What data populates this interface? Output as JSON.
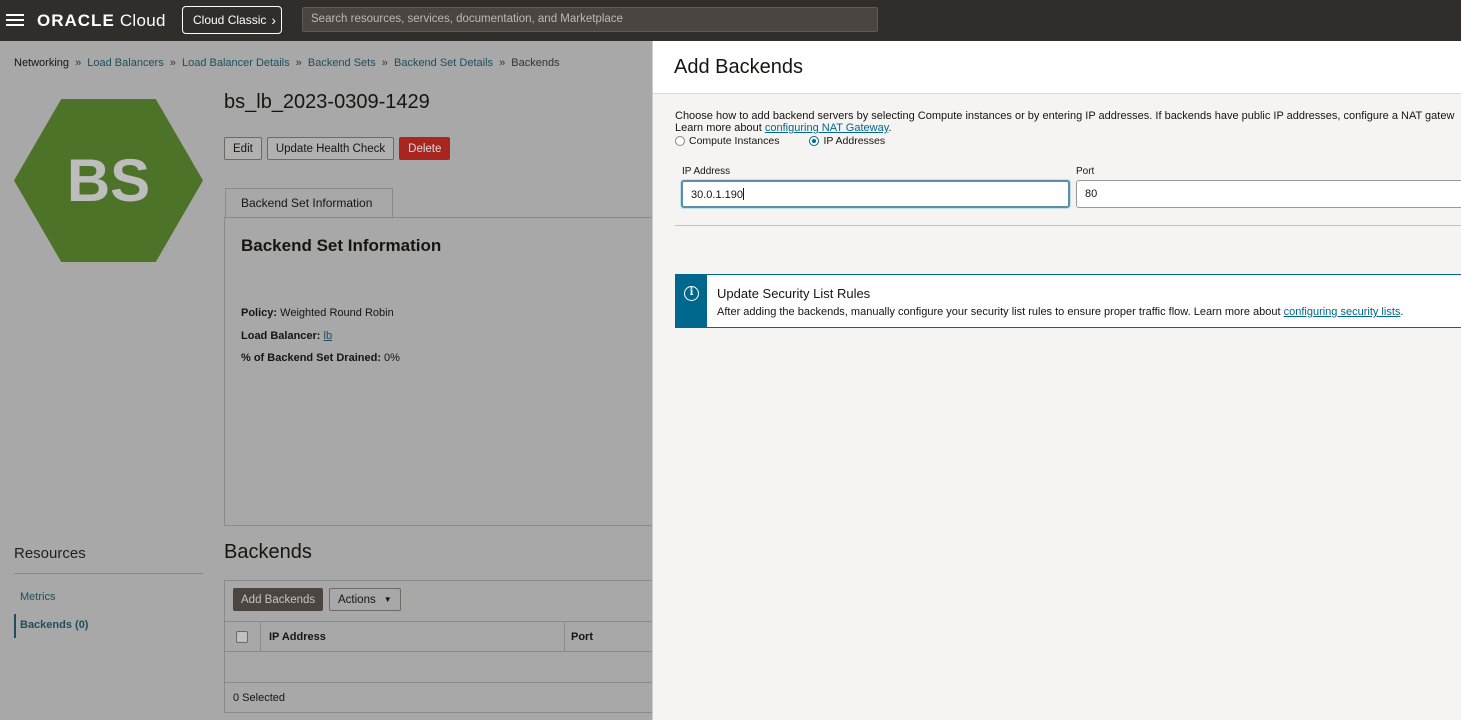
{
  "topbar": {
    "logo_brand": "ORACLE",
    "logo_product": "Cloud",
    "classic_button": "Cloud Classic",
    "search_placeholder": "Search resources, services, documentation, and Marketplace"
  },
  "breadcrumbs": {
    "root": "Networking",
    "items": [
      "Load Balancers",
      "Load Balancer Details",
      "Backend Sets",
      "Backend Set Details"
    ],
    "current": "Backends",
    "separator": "»"
  },
  "backend_set": {
    "icon_text": "BS",
    "name": "bs_lb_2023-0309-1429",
    "buttons": {
      "edit": "Edit",
      "health": "Update Health Check",
      "delete": "Delete"
    },
    "tab_label": "Backend Set Information",
    "info_heading": "Backend Set Information",
    "policy_label": "Policy:",
    "policy_value": "Weighted Round Robin",
    "lb_label": "Load Balancer:",
    "lb_value": "lb",
    "drained_label": "% of Backend Set Drained:",
    "drained_value": "0%"
  },
  "resources": {
    "heading": "Resources",
    "items": [
      "Metrics",
      "Backends (0)"
    ]
  },
  "backends": {
    "heading": "Backends",
    "add_button": "Add Backends",
    "actions_button": "Actions",
    "columns": [
      "IP Address",
      "Port"
    ],
    "selected": "0 Selected"
  },
  "panel": {
    "title": "Add Backends",
    "description_line1": "Choose how to add backend servers by selecting Compute instances or by entering IP addresses. If backends have public IP addresses, configure a NAT gatew",
    "description_line2_prefix": "Learn more about ",
    "description_link": "configuring NAT Gateway",
    "description_line2_suffix": ".",
    "radio_compute": "Compute Instances",
    "radio_ip": "IP Addresses",
    "selected_mode": "IP Addresses",
    "ip_label": "IP Address",
    "ip_value": "30.0.1.190",
    "port_label": "Port",
    "port_value": "80",
    "alert": {
      "title": "Update Security List Rules",
      "text": "After adding the backends, manually configure your security list rules to ensure proper traffic flow. Learn more about ",
      "link": "configuring security lists",
      "suffix": "."
    }
  },
  "colors": {
    "topbar": "#312d2a",
    "hex_badge": "#4d7328",
    "delete_button": "#a8261f",
    "accent": "#00688c",
    "link": "#1f4e5c"
  }
}
